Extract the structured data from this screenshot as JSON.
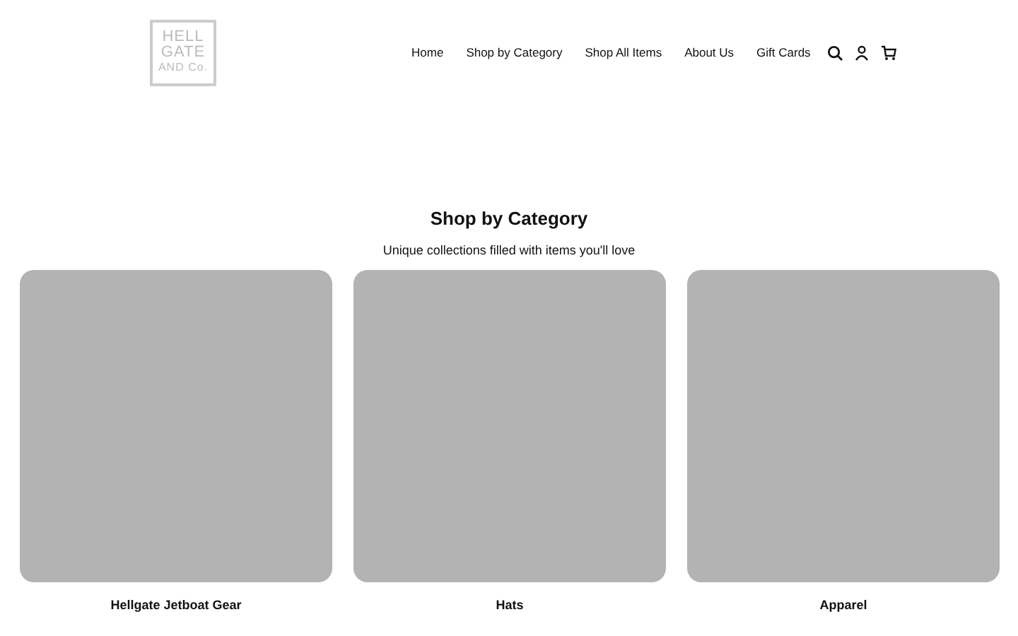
{
  "logo": {
    "lines": [
      "HELL",
      "GATE",
      "AND Co."
    ]
  },
  "nav": [
    {
      "label": "Home"
    },
    {
      "label": "Shop by Category"
    },
    {
      "label": "Shop All Items"
    },
    {
      "label": "About Us"
    },
    {
      "label": "Gift Cards"
    }
  ],
  "header_icons": [
    {
      "kind": "search"
    },
    {
      "kind": "account"
    },
    {
      "kind": "cart"
    }
  ],
  "section": {
    "title": "Shop by Category",
    "subtitle": "Unique collections filled with items you'll love"
  },
  "categories": [
    {
      "name": "Hellgate Jetboat Gear"
    },
    {
      "name": "Hats"
    },
    {
      "name": "Apparel"
    }
  ]
}
